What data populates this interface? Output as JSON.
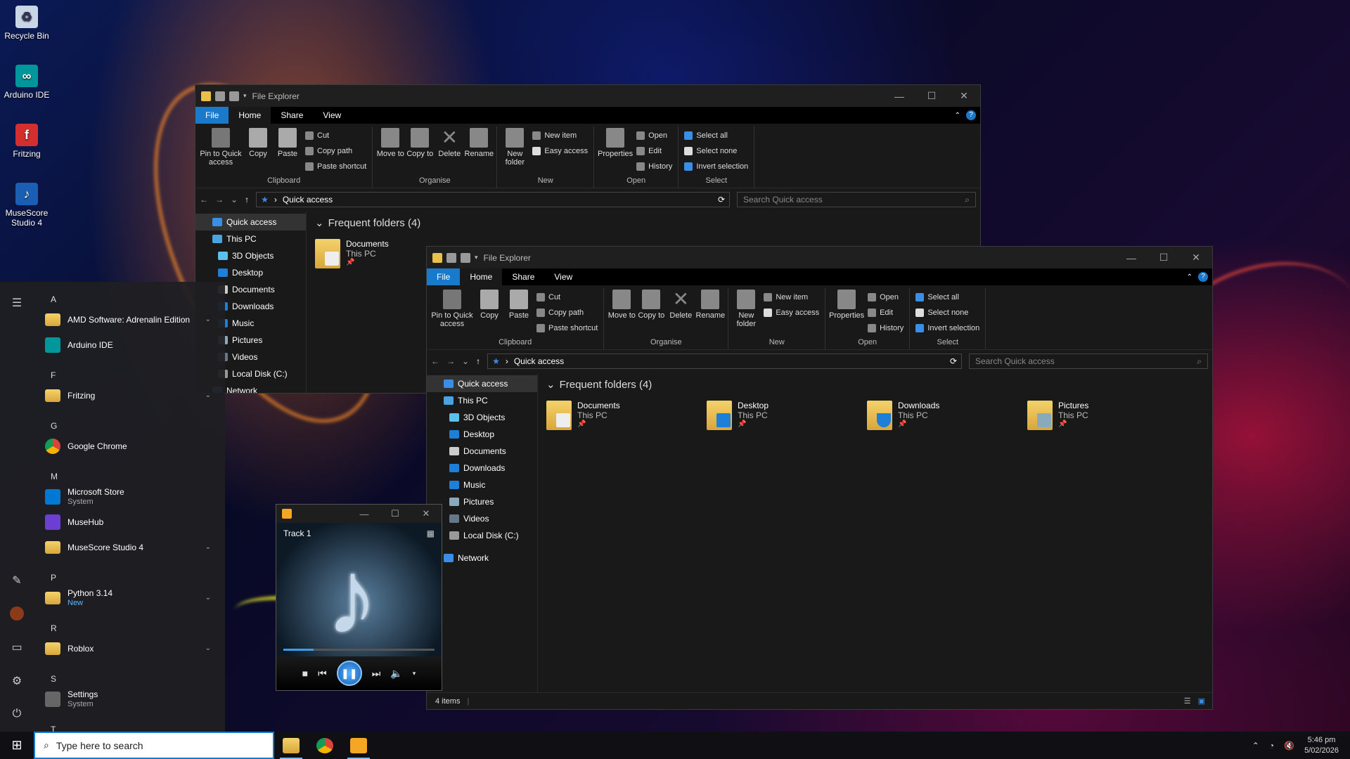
{
  "desktop": {
    "icons": [
      {
        "label": "Recycle Bin",
        "icon": "recycle-bin-icon"
      },
      {
        "label": "Arduino IDE",
        "icon": "arduino-icon"
      },
      {
        "label": "Fritzing",
        "icon": "fritzing-icon"
      },
      {
        "label": "MuseScore Studio 4",
        "icon": "musescore-icon"
      }
    ]
  },
  "explorer": {
    "title": "File Explorer",
    "tabs": [
      "File",
      "Home",
      "Share",
      "View"
    ],
    "clipboard": {
      "pin": "Pin to Quick access",
      "copy": "Copy",
      "paste": "Paste",
      "cut": "Cut",
      "copy_path": "Copy path",
      "paste_shortcut": "Paste shortcut",
      "label": "Clipboard"
    },
    "organise": {
      "move": "Move to",
      "copy": "Copy to",
      "delete": "Delete",
      "rename": "Rename",
      "label": "Organise"
    },
    "new": {
      "new_folder": "New folder",
      "new_item": "New item",
      "easy_access": "Easy access",
      "label": "New"
    },
    "open": {
      "properties": "Properties",
      "open": "Open",
      "edit": "Edit",
      "history": "History",
      "label": "Open"
    },
    "select": {
      "all": "Select all",
      "none": "Select none",
      "invert": "Invert selection",
      "label": "Select"
    },
    "path": "Quick access",
    "search_placeholder": "Search Quick access",
    "nav": [
      "Quick access",
      "This PC",
      "3D Objects",
      "Desktop",
      "Documents",
      "Downloads",
      "Music",
      "Pictures",
      "Videos",
      "Local Disk (C:)",
      "Network"
    ],
    "section": "Frequent folders (4)",
    "folders": [
      {
        "name": "Documents",
        "loc": "This PC"
      },
      {
        "name": "Desktop",
        "loc": "This PC"
      },
      {
        "name": "Downloads",
        "loc": "This PC"
      },
      {
        "name": "Pictures",
        "loc": "This PC"
      }
    ],
    "status": "4 items"
  },
  "start": {
    "entries": [
      {
        "type": "header",
        "text": "A"
      },
      {
        "type": "app",
        "text": "AMD Software: Adrenalin Edition",
        "icon": "folder",
        "chev": true
      },
      {
        "type": "app",
        "text": "Arduino IDE",
        "icon": "arduino"
      },
      {
        "type": "header",
        "text": "F"
      },
      {
        "type": "app",
        "text": "Fritzing",
        "icon": "folder",
        "chev": true
      },
      {
        "type": "header",
        "text": "G"
      },
      {
        "type": "app",
        "text": "Google Chrome",
        "icon": "chrome"
      },
      {
        "type": "header",
        "text": "M"
      },
      {
        "type": "app",
        "text": "Microsoft Store",
        "sub": "System",
        "icon": "store"
      },
      {
        "type": "app",
        "text": "MuseHub",
        "icon": "musehub"
      },
      {
        "type": "app",
        "text": "MuseScore Studio 4",
        "icon": "folder",
        "chev": true
      },
      {
        "type": "header",
        "text": "P"
      },
      {
        "type": "app",
        "text": "Python 3.14",
        "sub": "New",
        "icon": "folder",
        "chev": true
      },
      {
        "type": "header",
        "text": "R"
      },
      {
        "type": "app",
        "text": "Roblox",
        "icon": "folder",
        "chev": true
      },
      {
        "type": "header",
        "text": "S"
      },
      {
        "type": "app",
        "text": "Settings",
        "sub": "System",
        "icon": "settings"
      },
      {
        "type": "header",
        "text": "T"
      }
    ]
  },
  "player": {
    "track": "Track 1",
    "progress": 0.2
  },
  "taskbar": {
    "search_placeholder": "Type here to search",
    "time": "5:46 pm",
    "date": "5/02/2026"
  },
  "colors": {
    "accent": "#1979ca",
    "dark_bg": "#191919"
  }
}
